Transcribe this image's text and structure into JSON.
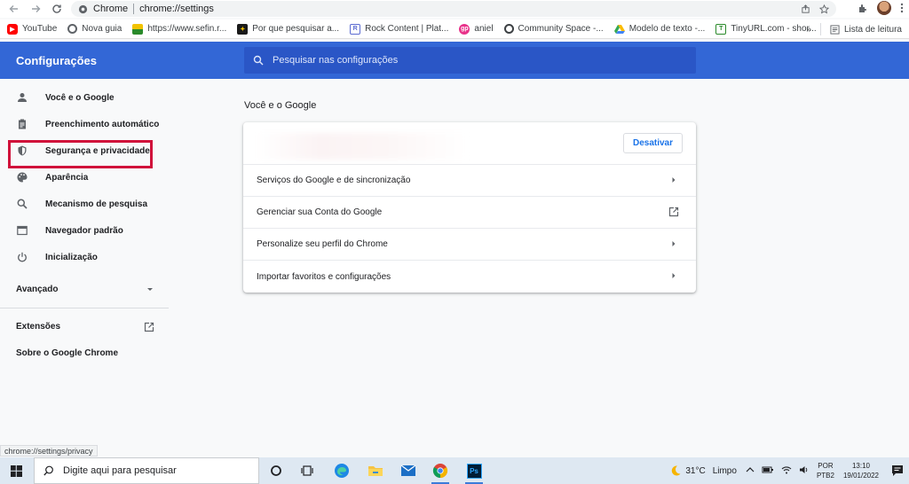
{
  "browser": {
    "tab_label": "Chrome",
    "url": "chrome://settings"
  },
  "bookmarks": [
    {
      "label": "YouTube",
      "icon": "youtube-icon",
      "color": "#ff0000"
    },
    {
      "label": "Nova guia",
      "icon": "chrome-icon",
      "color": "#5f6368"
    },
    {
      "label": "https://www.sefin.r...",
      "icon": "sefin-icon",
      "color": "#f2c200"
    },
    {
      "label": "Por que pesquisar a...",
      "icon": "bookmark-icon",
      "color": "#1a1a1a"
    },
    {
      "label": "Rock Content | Plat...",
      "icon": "rock-icon",
      "color": "#5b6bd1"
    },
    {
      "label": "aniel",
      "icon": "gp-icon",
      "color": "#e8328a"
    },
    {
      "label": "Community Space -...",
      "icon": "community-icon",
      "color": "#3c4043"
    },
    {
      "label": "Modelo de texto -...",
      "icon": "drive-icon",
      "color": "#34a853"
    },
    {
      "label": "TinyURL.com - shor...",
      "icon": "tinyurl-icon",
      "color": "#2a8a2a"
    }
  ],
  "bookmarks_overflow": "»",
  "reading_list": "Lista de leitura",
  "header": {
    "title": "Configurações",
    "search_placeholder": "Pesquisar nas configurações"
  },
  "sidebar": {
    "items": [
      {
        "label": "Você e o Google",
        "icon": "person-icon"
      },
      {
        "label": "Preenchimento automático",
        "icon": "clipboard-icon"
      },
      {
        "label": "Segurança e privacidade",
        "icon": "shield-icon"
      },
      {
        "label": "Aparência",
        "icon": "palette-icon"
      },
      {
        "label": "Mecanismo de pesquisa",
        "icon": "search-icon"
      },
      {
        "label": "Navegador padrão",
        "icon": "browser-icon"
      },
      {
        "label": "Inicialização",
        "icon": "power-icon"
      }
    ],
    "advanced": "Avançado",
    "extensions": "Extensões",
    "about": "Sobre o Google Chrome"
  },
  "main": {
    "section_title": "Você e o Google",
    "deactivate_button": "Desativar",
    "rows": [
      {
        "label": "Serviços do Google e de sincronização",
        "icon": "arrow-right-icon"
      },
      {
        "label": "Gerenciar sua Conta do Google",
        "icon": "external-link-icon"
      },
      {
        "label": "Personalize seu perfil do Chrome",
        "icon": "arrow-right-icon"
      },
      {
        "label": "Importar favoritos e configurações",
        "icon": "arrow-right-icon"
      }
    ]
  },
  "status_url": "chrome://settings/privacy",
  "taskbar": {
    "search_placeholder": "Digite aqui para pesquisar",
    "temperature": "31°C",
    "weather": "Limpo",
    "lang_line1": "POR",
    "lang_line2": "PTB2",
    "time": "13:10",
    "date": "19/01/2022"
  },
  "colors": {
    "header_blue": "#3367d6",
    "highlight_red": "#d0103a",
    "link_blue": "#1a73e8"
  }
}
